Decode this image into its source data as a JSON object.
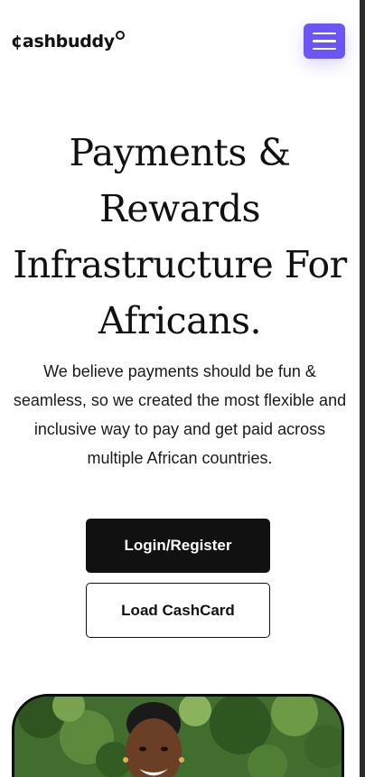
{
  "header": {
    "logo_text": "¢ashbuddy",
    "menu_icon": "hamburger-menu-icon",
    "menu_color": "#6c55f6"
  },
  "hero": {
    "title_lines": [
      "Payments &",
      "Rewards",
      "Infrastructure For",
      "Africans."
    ],
    "description": "We believe payments should be fun & seamless, so we created the most flexible and inclusive way to pay and get paid across multiple African countries."
  },
  "actions": {
    "login_label": "Login/Register",
    "cashcard_label": "Load CashCard"
  },
  "hero_image": {
    "subject": "woman-portrait"
  }
}
